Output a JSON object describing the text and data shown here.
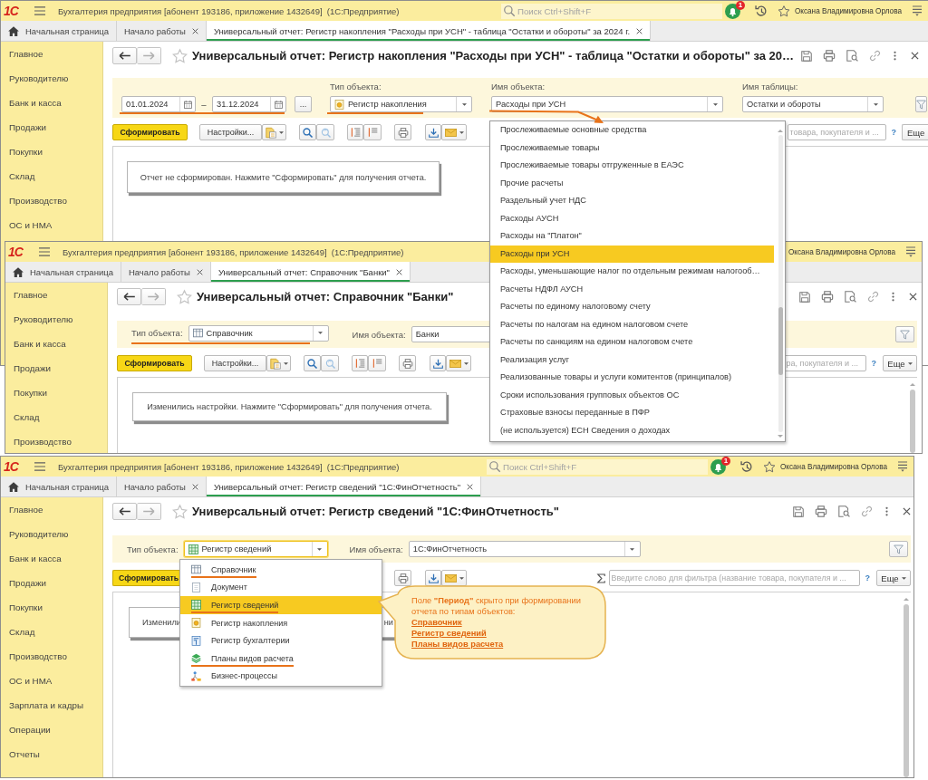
{
  "windows": [
    {
      "logo": "1С",
      "app_title": "Бухгалтерия предприятия [абонент 193186, приложение 1432649]  (1С:Предприятие)",
      "search": {
        "placeholder": "Поиск Ctrl+Shift+F"
      },
      "notification_count": "1",
      "user": "Оксана Владимировна Орлова",
      "tabs": [
        {
          "label": "Начальная страница",
          "kind": "home",
          "selected": false
        },
        {
          "label": "Начало работы",
          "kind": "closable",
          "selected": false
        },
        {
          "label": "Универсальный отчет: Регистр накопления \"Расходы при УСН\" - таблица \"Остатки и обороты\" за 2024 г.",
          "kind": "closable",
          "selected": true
        }
      ],
      "sidebar": [
        "Главное",
        "Руководителю",
        "Банк и касса",
        "Продажи",
        "Покупки",
        "Склад",
        "Производство",
        "ОС и НМА"
      ],
      "report_title": "Универсальный отчет: Регистр накопления \"Расходы при УСН\" - таблица \"Остатки и обороты\" за 20…",
      "filters": {
        "period": {
          "from": "01.01.2024",
          "separator": "–",
          "to": "31.12.2024",
          "choose": "...",
          "annotated": true
        },
        "object_type": {
          "label": "Тип объекта:",
          "value": "Регистр накопления",
          "kind": "accumulation_register",
          "annotated": true
        },
        "object_name": {
          "label": "Имя объекта:",
          "value": "Расходы при УСН",
          "arrow_to_list": true
        },
        "table_name": {
          "label": "Имя таблицы:",
          "value": "Остатки и обороты"
        }
      },
      "toolbar": {
        "generate": "Сформировать",
        "settings": "Настройки...",
        "search": {
          "placeholder": "товара, покупателя и ..."
        },
        "help": "?",
        "more": "Еще"
      },
      "message": "Отчет не сформирован. Нажмите \"Сформировать\" для получения отчета.",
      "object_name_list": {
        "items": [
          {
            "label": "Прослеживаемые основные средства",
            "selected": false
          },
          {
            "label": "Прослеживаемые товары",
            "selected": false
          },
          {
            "label": "Прослеживаемые товары отгруженные в ЕАЭС",
            "selected": false
          },
          {
            "label": "Прочие расчеты",
            "selected": false
          },
          {
            "label": "Раздельный учет НДС",
            "selected": false
          },
          {
            "label": "Расходы АУСН",
            "selected": false
          },
          {
            "label": "Расходы на \"Платон\"",
            "selected": false
          },
          {
            "label": "Расходы при УСН",
            "selected": true
          },
          {
            "label": "Расходы, уменьшающие налог по отдельным режимам налогооб…",
            "selected": false
          },
          {
            "label": "Расчеты НДФЛ АУСН",
            "selected": false
          },
          {
            "label": "Расчеты по единому налоговому счету",
            "selected": false
          },
          {
            "label": "Расчеты по налогам на едином налоговом счете",
            "selected": false
          },
          {
            "label": "Расчеты по санкциям на едином налоговом счете",
            "selected": false
          },
          {
            "label": "Реализация услуг",
            "selected": false
          },
          {
            "label": "Реализованные товары и услуги комитентов (принципалов)",
            "selected": false
          },
          {
            "label": "Сроки использования групповых объектов ОС",
            "selected": false
          },
          {
            "label": "Страховые взносы переданные в ПФР",
            "selected": false
          },
          {
            "label": "(не используется) ЕСН Сведения о доходах",
            "selected": false
          }
        ]
      }
    },
    {
      "logo": "1С",
      "app_title": "Бухгалтерия предприятия [абонент 193186, приложение 1432649]  (1С:Предприятие)",
      "user": "Оксана Владимировна Орлова",
      "tabs": [
        {
          "label": "Начальная страница",
          "kind": "home",
          "selected": false
        },
        {
          "label": "Начало работы",
          "kind": "closable",
          "selected": false
        },
        {
          "label": "Универсальный отчет: Справочник \"Банки\"",
          "kind": "closable",
          "selected": true
        }
      ],
      "sidebar": [
        "Главное",
        "Руководителю",
        "Банк и касса",
        "Продажи",
        "Покупки",
        "Склад",
        "Производство"
      ],
      "report_title": "Универсальный отчет: Справочник \"Банки\"",
      "filters": {
        "object_type": {
          "label": "Тип объекта:",
          "value": "Справочник",
          "kind": "catalog",
          "annotated": true
        },
        "object_name": {
          "label": "Имя объекта:",
          "value": "Банки"
        }
      },
      "toolbar": {
        "generate": "Сформировать",
        "settings": "Настройки...",
        "search": {
          "placeholder": "ра, покупателя и ..."
        },
        "help": "?",
        "more": "Еще"
      },
      "message": "Изменились настройки. Нажмите \"Сформировать\" для получения отчета."
    },
    {
      "logo": "1С",
      "app_title": "Бухгалтерия предприятия [абонент 193186, приложение 1432649]  (1С:Предприятие)",
      "search": {
        "placeholder": "Поиск Ctrl+Shift+F"
      },
      "notification_count": "1",
      "user": "Оксана Владимировна Орлова",
      "tabs": [
        {
          "label": "Начальная страница",
          "kind": "home",
          "selected": false
        },
        {
          "label": "Начало работы",
          "kind": "closable",
          "selected": false
        },
        {
          "label": "Универсальный отчет: Регистр сведений \"1С:ФинОтчетность\"",
          "kind": "closable",
          "selected": true
        }
      ],
      "sidebar": [
        "Главное",
        "Руководителю",
        "Банк и касса",
        "Продажи",
        "Покупки",
        "Склад",
        "Производство",
        "ОС и НМА",
        "Зарплата и кадры",
        "Операции",
        "Отчеты"
      ],
      "report_title": "Универсальный отчет: Регистр сведений \"1С:ФинОтчетность\"",
      "filters": {
        "object_type": {
          "label": "Тип объекта:",
          "value": "Регистр сведений",
          "kind": "info_register",
          "focused": true
        },
        "object_name": {
          "label": "Имя объекта:",
          "value": "1С:ФинОтчетность"
        }
      },
      "toolbar": {
        "generate": "Сформировать",
        "search": {
          "placeholder": "Введите слово для фильтра (название товара, покупателя и ..."
        },
        "help": "?",
        "more": "Еще"
      },
      "message_parts": [
        "Изменили",
        "ни"
      ],
      "object_type_list": {
        "items": [
          {
            "label": "Справочник",
            "kind": "catalog",
            "selected": false,
            "annotated": true
          },
          {
            "label": "Документ",
            "kind": "document",
            "selected": false,
            "annotated": false
          },
          {
            "label": "Регистр сведений",
            "kind": "info_register",
            "selected": true,
            "annotated": true
          },
          {
            "label": "Регистр накопления",
            "kind": "accumulation_register",
            "selected": false,
            "annotated": false
          },
          {
            "label": "Регистр бухгалтерии",
            "kind": "accounting_register",
            "selected": false,
            "annotated": false
          },
          {
            "label": "Планы видов расчета",
            "kind": "calculation_types",
            "selected": false,
            "annotated": true
          },
          {
            "label": "Бизнес-процессы",
            "kind": "business_process",
            "selected": false,
            "annotated": false
          }
        ]
      },
      "callout": {
        "text": "Поле **\"Период\"** скрыто при формировании отчета по типам объектов:",
        "links": [
          "Справочник",
          "Регистр сведений",
          "Планы видов расчета"
        ]
      }
    }
  ]
}
